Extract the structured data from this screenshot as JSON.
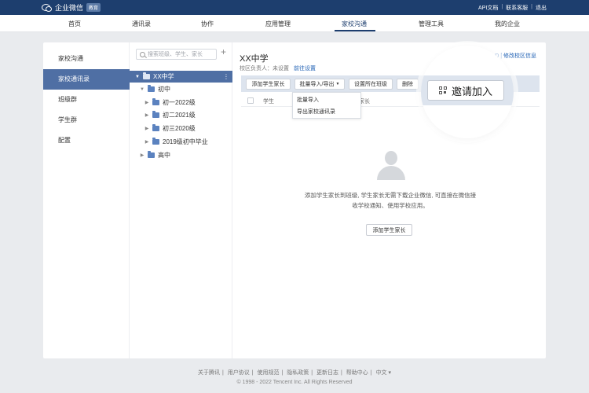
{
  "topbar": {
    "brand": "企业微信",
    "badge": "教育",
    "links": [
      "API文档",
      "联系客服",
      "退出"
    ]
  },
  "nav": {
    "items": [
      "首页",
      "通讯录",
      "协作",
      "应用管理",
      "家校沟通",
      "管理工具",
      "我的企业"
    ],
    "active": "家校沟通"
  },
  "sidebar": {
    "items": [
      "家校沟通",
      "家校通讯录",
      "班级群",
      "学生群",
      "配置"
    ],
    "active": "家校通讯录"
  },
  "tree": {
    "search_placeholder": "搜索班级、学生、家长",
    "root": "XX中学",
    "junior": "初中",
    "grades": [
      "初一2022级",
      "初二2021级",
      "初三2020级",
      "2019级初中毕业"
    ],
    "senior": "高中"
  },
  "content": {
    "school_name": "XX中学",
    "owner_label": "校区负责人：未设置",
    "owner_link": "前往设置",
    "top_right": "D | 修改校区信息",
    "toolbar": {
      "add": "添加学生家长",
      "batch": "批量导入/导出",
      "set_class": "设置所在班级",
      "delete": "删除"
    },
    "table_headers": [
      "学生",
      "家长"
    ],
    "dropdown": [
      "批量导入",
      "导出家校通讯录"
    ],
    "empty_text": "添加学生家长到班级, 学生家长无需下载企业微信, 可直接在微信接收学校通知、使用学校应用。",
    "empty_button": "添加学生家长",
    "invite": "邀请加入"
  },
  "footer": {
    "links": [
      "关于腾讯",
      "用户协议",
      "使用规范",
      "隐私政策",
      "更新日志",
      "帮助中心",
      "中文 ▾"
    ],
    "copyright": "© 1998 - 2022 Tencent Inc. All Rights Reserved"
  },
  "colors": {
    "topbar": "#1d3e6e",
    "active_blue": "#4f6fa4",
    "link": "#1d5fb3"
  }
}
